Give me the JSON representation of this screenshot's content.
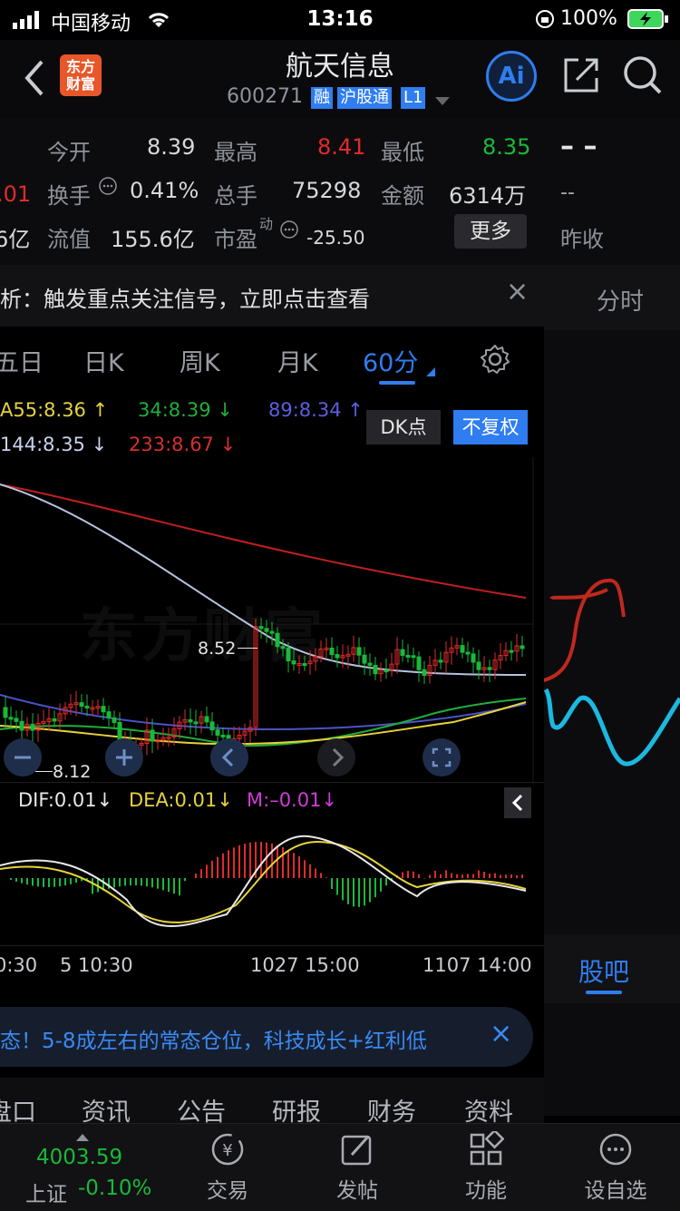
{
  "status": {
    "carrier": "中国移动",
    "time": "13:16",
    "battery": "100%"
  },
  "header": {
    "logo_text": "东方\n财富",
    "title": "航天信息",
    "code": "600271",
    "badges": [
      "融",
      "沪股通",
      "L1"
    ],
    "ai_label": "Ai"
  },
  "quote": {
    "rows": [
      [
        {
          "l": "今开",
          "v": "8.39",
          "c": "val"
        },
        {
          "l": "最高",
          "v": "8.41",
          "c": "red"
        },
        {
          "l": "最低",
          "v": "8.35",
          "c": "green"
        }
      ],
      [
        {
          "l": "换手",
          "v": "0.41%",
          "c": "val"
        },
        {
          "l": "总手",
          "v": "75298",
          "c": "val"
        },
        {
          "l": "金额",
          "v": "6314万",
          "c": "val"
        }
      ],
      [
        {
          "l": "流值",
          "v": "155.6亿",
          "c": "val"
        },
        {
          "l": "市盈",
          "v": "-25.50",
          "c": "val"
        }
      ]
    ],
    "left_partial_1": ".01",
    "left_partial_2": "6亿",
    "pe_sup": "动",
    "more_label": "更多",
    "right_dash_top": "– –",
    "right_dash_mid": "--",
    "right_prev_close": "昨收"
  },
  "signal_banner": {
    "text": "析：触发重点关注信号，立即点击查看",
    "close": "×"
  },
  "right_panel": {
    "timeshare_tab": "分时",
    "guba_tab": "股吧"
  },
  "period_tabs": {
    "items": [
      "五日",
      "日K",
      "周K",
      "月K",
      "60分"
    ],
    "active": "60分"
  },
  "chart": {
    "ma_row1": [
      {
        "t": "A55:8.36 ↑",
        "color": "#e6d33a"
      },
      {
        "t": "34:8.39 ↓",
        "color": "#1fae3a"
      },
      {
        "t": "89:8.34 ↑",
        "color": "#5a5fe0"
      }
    ],
    "ma_row2": [
      {
        "t": "144:8.35 ↓",
        "color": "#c8d2f0"
      },
      {
        "t": "233:8.67 ↓",
        "color": "#d63030"
      }
    ],
    "dk_label": "DK点",
    "fq_label": "不复权",
    "watermark": "东方财富",
    "max_label": "8.52",
    "min_label": "8.12",
    "macd_labels": [
      {
        "t": "DIF:0.01↓",
        "color": "#e8e8e8"
      },
      {
        "t": "DEA:0.01↓",
        "color": "#e6d33a"
      },
      {
        "t": "M:–0.01↓",
        "color": "#d23ad8"
      }
    ],
    "x_labels": [
      "0:30",
      "5 10:30",
      "1027 15:00",
      "1107 14:00"
    ]
  },
  "news_banner": {
    "text": "态！5-8成左右的常态仓位，科技成长+红利低",
    "close": "×"
  },
  "sub_tabs": [
    "盘口",
    "资讯",
    "公告",
    "研报",
    "财务",
    "资料"
  ],
  "bottom": {
    "index_value": "4003.59",
    "index_name": "上证",
    "index_change": "-0.10%",
    "items": [
      "交易",
      "发帖",
      "功能",
      "设自选"
    ]
  },
  "colors": {
    "accent": "#2f7df0",
    "up": "#e02b2b",
    "down": "#19b93a"
  }
}
